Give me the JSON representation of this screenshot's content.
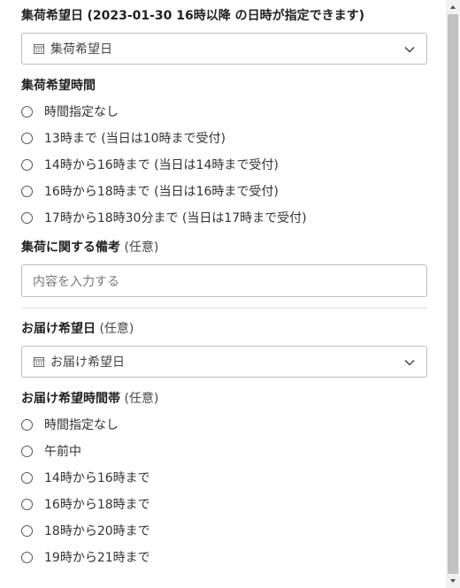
{
  "pickup_date": {
    "label": "集荷希望日",
    "note": "(2023-01-30 16時以降 の日時が指定できます)",
    "select_text": "集荷希望日"
  },
  "pickup_time": {
    "label": "集荷希望時間",
    "options": [
      "時間指定なし",
      "13時まで (当日は10時まで受付)",
      "14時から16時まで (当日は14時まで受付)",
      "16時から18時まで (当日は16時まで受付)",
      "17時から18時30分まで (当日は17時まで受付)"
    ]
  },
  "pickup_note": {
    "label": "集荷に関する備考",
    "optional": "(任意)",
    "placeholder": "内容を入力する"
  },
  "delivery_date": {
    "label": "お届け希望日",
    "optional": "(任意)",
    "select_text": "お届け希望日"
  },
  "delivery_time": {
    "label": "お届け希望時間帯",
    "optional": "(任意)",
    "options": [
      "時間指定なし",
      "午前中",
      "14時から16時まで",
      "16時から18時まで",
      "18時から20時まで",
      "19時から21時まで"
    ]
  },
  "icons": {
    "calendar": "calendar-icon",
    "chevron": "chevron-down-icon"
  }
}
